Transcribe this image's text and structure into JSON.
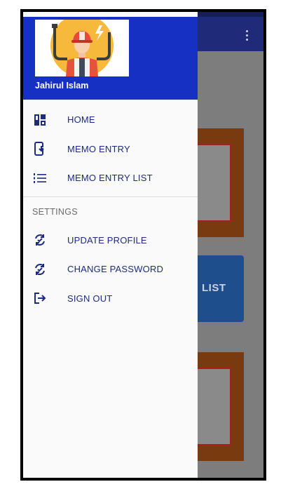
{
  "colors": {
    "drawer_header": "#1530c2",
    "menu_text": "#1c2a80",
    "avatar_circle": "#f6b93b",
    "app_bar": "#1f2a78"
  },
  "drawer": {
    "user_name": "Jahirul Islam",
    "avatar_icon": "engineer-avatar-icon",
    "main_items": [
      {
        "label": "HOME",
        "icon": "dashboard-icon"
      },
      {
        "label": "MEMO ENTRY",
        "icon": "phone-download-icon"
      },
      {
        "label": "MEMO ENTRY LIST",
        "icon": "numbered-list-icon"
      }
    ],
    "settings_title": "SETTINGS",
    "settings_items": [
      {
        "label": "UPDATE PROFILE",
        "icon": "sync-check-icon"
      },
      {
        "label": "CHANGE PASSWORD",
        "icon": "sync-check-icon"
      },
      {
        "label": "SIGN OUT",
        "icon": "logout-icon"
      }
    ]
  },
  "background_app": {
    "visible_button_fragment": "LIST",
    "overflow_icon": "more-vert-icon"
  }
}
